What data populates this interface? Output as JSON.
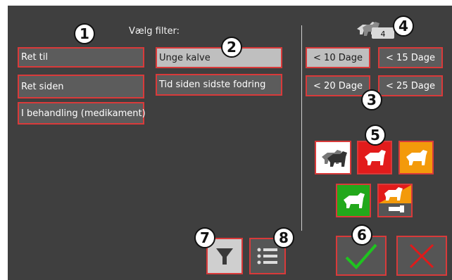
{
  "title": "Vælg filter:",
  "left_buttons": {
    "ret_til": "Ret til",
    "ret_siden": "Ret siden",
    "i_behandling": "I behandling (medikament)",
    "unge_kalve": "Unge kalve",
    "tid_siden": "Tid siden sidste fodring"
  },
  "day_buttons": [
    "< 10 Dage",
    "< 15 Dage",
    "< 20 Dage",
    "< 25 Dage"
  ],
  "count_badge": "4",
  "markers": [
    "1",
    "2",
    "3",
    "4",
    "5",
    "6",
    "7",
    "8"
  ],
  "colors": {
    "red": "#e21b1b",
    "orange": "#f39a0b",
    "green": "#22a81b",
    "confirm_green": "#1fc41f",
    "cancel_red": "#e01a1a"
  },
  "icons": [
    "cow-pair-icon",
    "cow-red-icon",
    "cow-orange-icon",
    "cow-green-icon",
    "cow-medicine-icon",
    "filter-icon",
    "list-icon",
    "checkmark-icon",
    "x-icon"
  ]
}
